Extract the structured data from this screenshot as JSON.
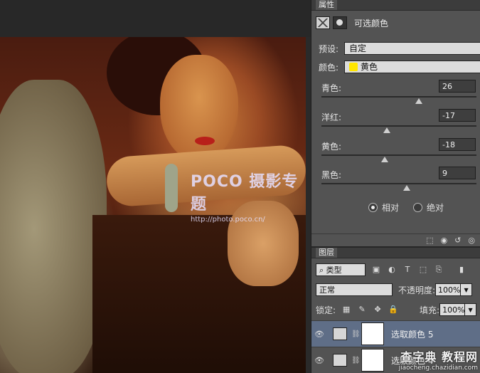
{
  "canvas": {
    "watermark_title": "POCO 摄影专题",
    "watermark_url": "http://photo.poco.cn/"
  },
  "properties": {
    "tab_label": "属性",
    "header_title": "可选颜色",
    "preset_label": "预设:",
    "preset_value": "自定",
    "color_label": "颜色:",
    "color_value": "黄色",
    "color_swatch": "#ffe600",
    "sliders": [
      {
        "label": "青色:",
        "value": "26",
        "level": 0.63
      },
      {
        "label": "洋红:",
        "value": "-17",
        "level": 0.42
      },
      {
        "label": "黄色:",
        "value": "-18",
        "level": 0.41
      },
      {
        "label": "黑色:",
        "value": "9",
        "level": 0.55
      }
    ],
    "radio_relative": "相对",
    "radio_absolute": "绝对",
    "relative_selected": true
  },
  "layers": {
    "tab_label": "图层",
    "filter_kind": "类型",
    "blend_mode": "正常",
    "opacity_label": "不透明度:",
    "opacity_value": "100%",
    "lock_label": "锁定:",
    "fill_label": "填充:",
    "fill_value": "100%",
    "items": [
      {
        "name": "选取颜色 5",
        "selected": true
      },
      {
        "name": "选取颜色 4",
        "selected": false
      }
    ]
  },
  "site_watermark": {
    "title": "查字典 教程网",
    "url": "jiaocheng.chazidian.com"
  }
}
